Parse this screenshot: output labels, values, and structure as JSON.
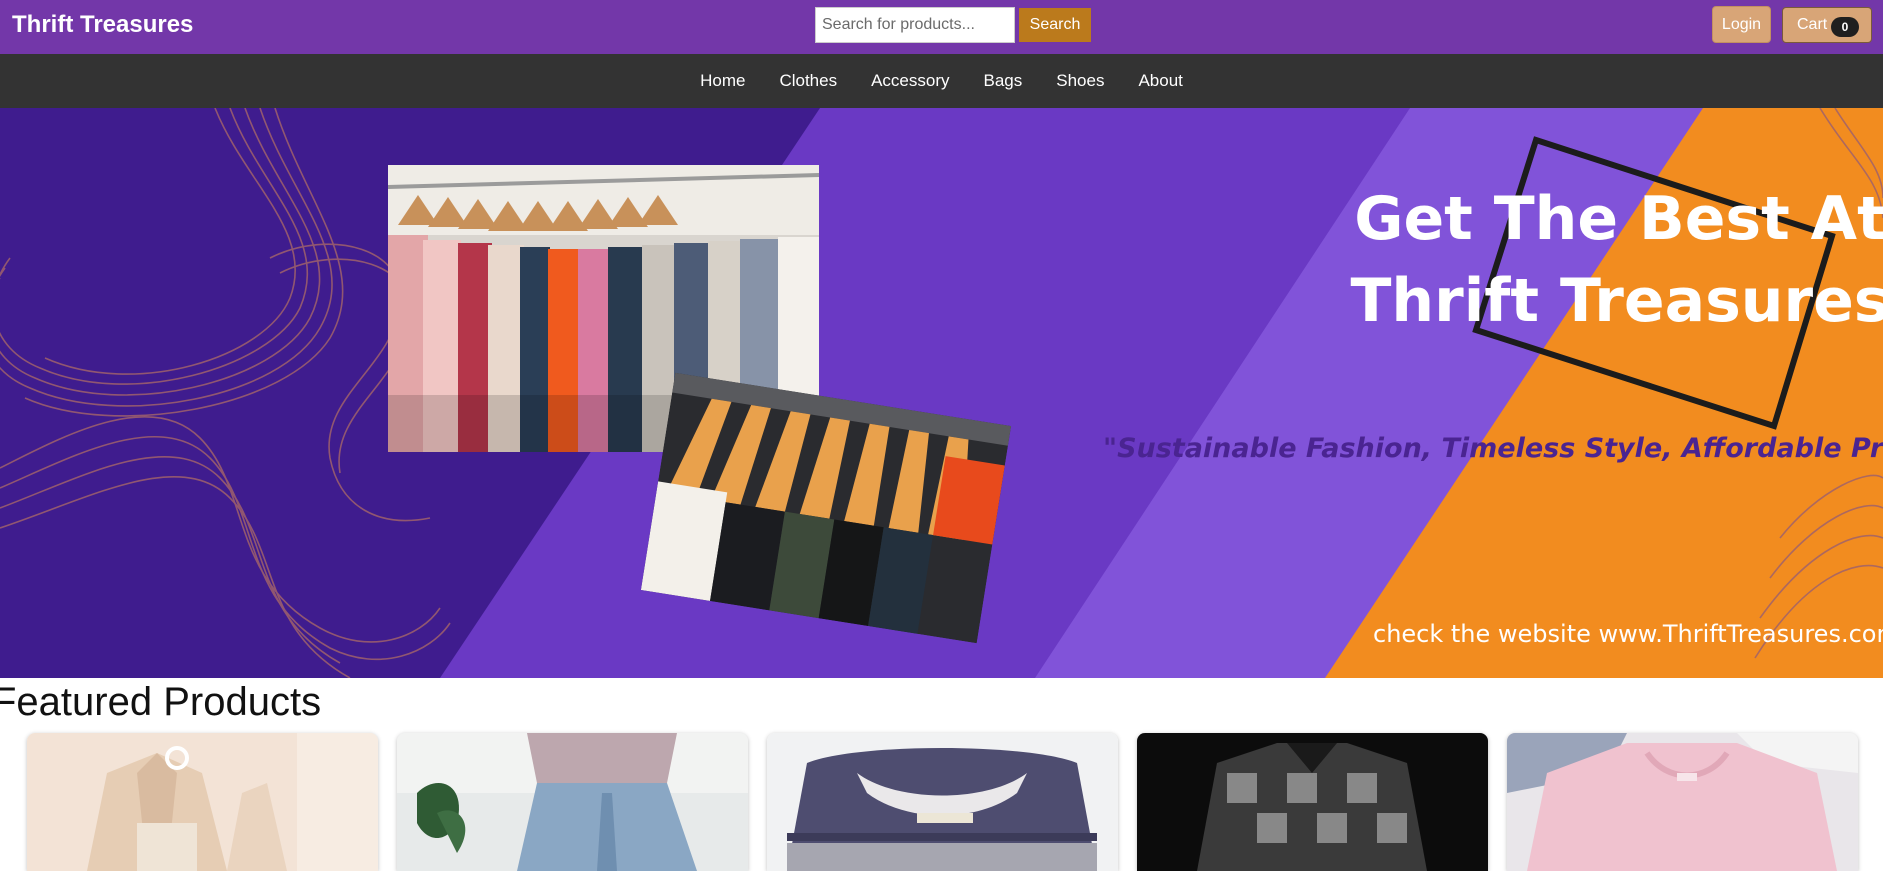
{
  "header": {
    "brand": "Thrift Treasures",
    "search_placeholder": "Search for products...",
    "search_label": "Search",
    "login_label": "Login",
    "cart_label": "Cart",
    "cart_count": "0"
  },
  "nav": {
    "items": [
      {
        "label": "Home"
      },
      {
        "label": "Clothes"
      },
      {
        "label": "Accessory"
      },
      {
        "label": "Bags"
      },
      {
        "label": "Shoes"
      },
      {
        "label": "About"
      }
    ]
  },
  "hero": {
    "title_line1": "Get The Best At",
    "title_line2": "Thrift Treasures",
    "tagline": "\"Sustainable Fashion, Timeless Style, Affordable Prices!\"",
    "website": "check the website www.ThriftTreasures.com"
  },
  "featured": {
    "heading": "Featured Products"
  },
  "colors": {
    "topbar": "#7337a9",
    "navbar": "#333333",
    "search_button": "#bb7a1c",
    "login_cart_button": "#d8a577",
    "hero_dark_purple": "#3f1c8e",
    "hero_mid_purple": "#6a39c4",
    "hero_light_purple": "#8153d9",
    "hero_orange": "#f28c1f"
  },
  "icons": {
    "hero_decoration": "wave-lines-icon",
    "hero_frame": "square-frame-icon"
  }
}
